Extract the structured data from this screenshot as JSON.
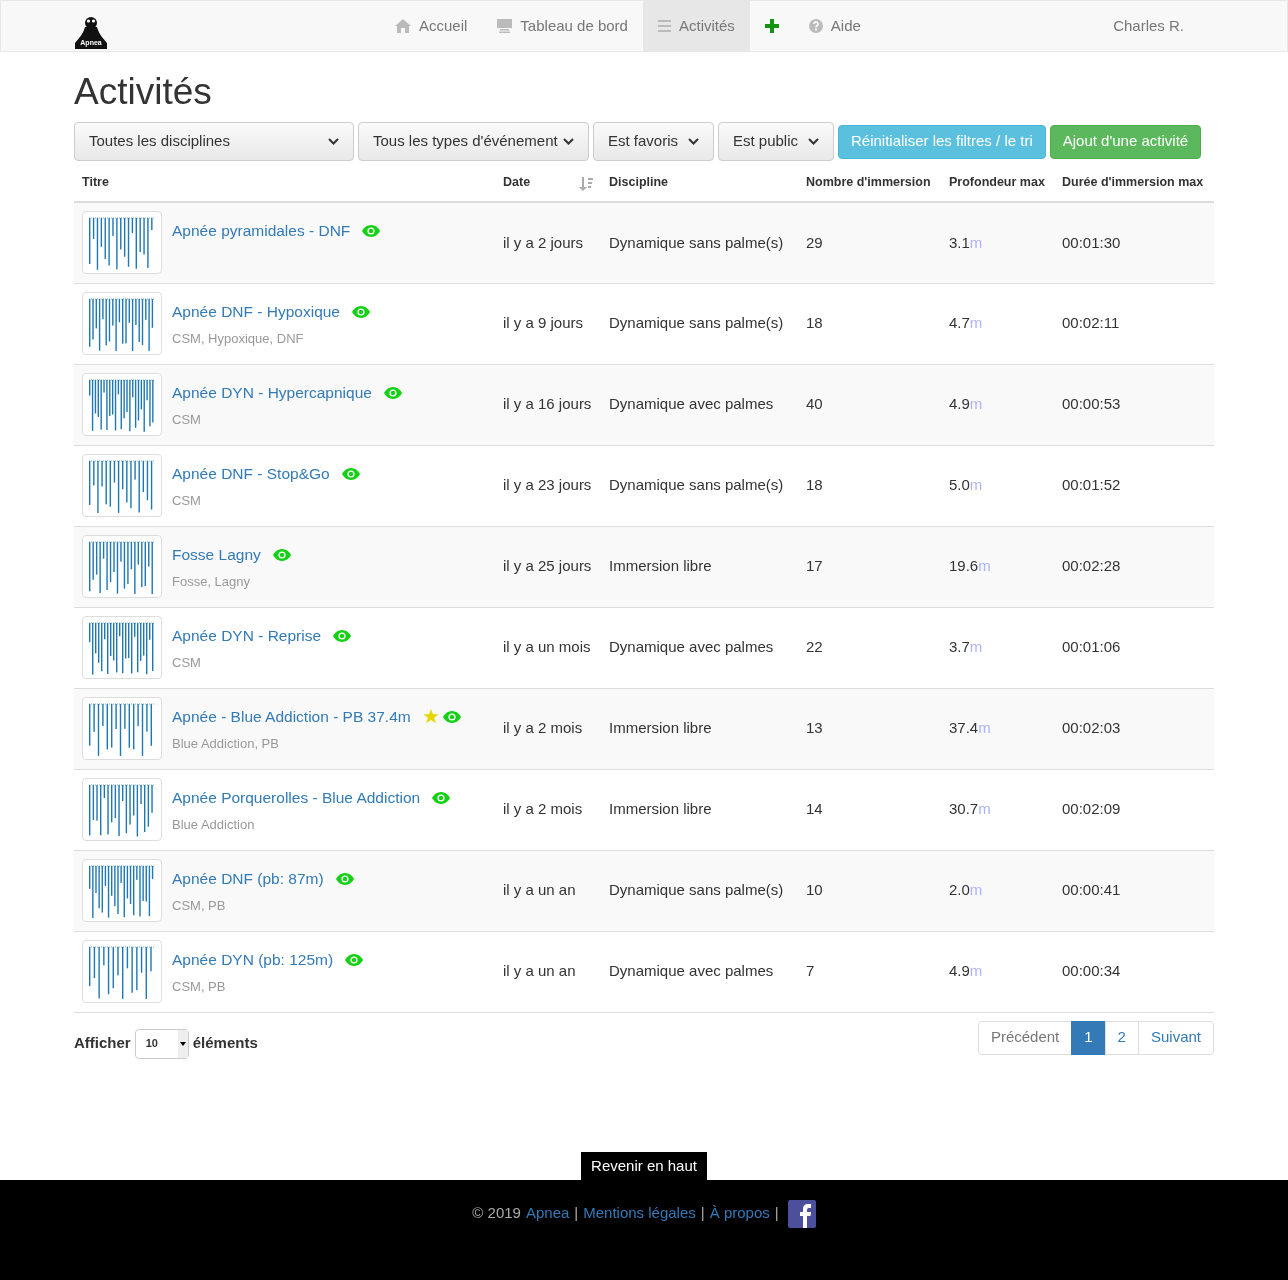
{
  "navbar": {
    "logo_text": "Apnea",
    "items": [
      {
        "kind": "home",
        "label": "Accueil",
        "selected": false
      },
      {
        "kind": "dashboard",
        "label": "Tableau de bord",
        "selected": false
      },
      {
        "kind": "list",
        "label": "Activités",
        "selected": true
      },
      {
        "kind": "add",
        "selected": false
      },
      {
        "kind": "help",
        "label": "Aide",
        "selected": false
      }
    ],
    "user": "Charles R."
  },
  "page_title": "Activités",
  "filters": [
    {
      "label": "Toutes les disciplines",
      "kind": "select"
    },
    {
      "label": "Tous les types d'événement",
      "kind": "select"
    },
    {
      "label": "Est favoris",
      "kind": "select"
    },
    {
      "label": "Est public",
      "kind": "select"
    },
    {
      "label": "Réinitialiser les filtres / le tri",
      "kind": "info"
    },
    {
      "label": "Ajout d'une activité",
      "kind": "success"
    }
  ],
  "table": {
    "columns": [
      {
        "label": "Titre"
      },
      {
        "label": "Date",
        "sorted": true
      },
      {
        "label": "Discipline"
      },
      {
        "label": "Nombre d'immersion"
      },
      {
        "label": "Profondeur max"
      },
      {
        "label": "Durée d'immersion max"
      }
    ],
    "rows": [
      {
        "title": "Apnée pyramidales - DNF",
        "favorite": false,
        "public": true,
        "date": "il y a 2 jours",
        "discipline": "Dynamique sans palme(s)",
        "count": "29",
        "depth": "3.1",
        "unit": "m",
        "duration": "00:01:30"
      },
      {
        "title": "Apnée DNF - Hypoxique",
        "tags": "CSM, Hypoxique, DNF",
        "favorite": false,
        "public": true,
        "date": "il y a 9 jours",
        "discipline": "Dynamique sans palme(s)",
        "count": "18",
        "depth": "4.7",
        "unit": "m",
        "duration": "00:02:11"
      },
      {
        "title": "Apnée DYN - Hypercapnique",
        "tags": "CSM",
        "favorite": false,
        "public": true,
        "date": "il y a 16 jours",
        "discipline": "Dynamique avec palmes",
        "count": "40",
        "depth": "4.9",
        "unit": "m",
        "duration": "00:00:53"
      },
      {
        "title": "Apnée DNF - Stop&Go",
        "tags": "CSM",
        "favorite": false,
        "public": true,
        "date": "il y a 23 jours",
        "discipline": "Dynamique sans palme(s)",
        "count": "18",
        "depth": "5.0",
        "unit": "m",
        "duration": "00:01:52"
      },
      {
        "title": "Fosse Lagny",
        "tags": "Fosse, Lagny",
        "favorite": false,
        "public": true,
        "date": "il y a 25 jours",
        "discipline": "Immersion libre",
        "count": "17",
        "depth": "19.6",
        "unit": "m",
        "duration": "00:02:28"
      },
      {
        "title": "Apnée DYN - Reprise",
        "tags": "CSM",
        "favorite": false,
        "public": true,
        "date": "il y a un mois",
        "discipline": "Dynamique avec palmes",
        "count": "22",
        "depth": "3.7",
        "unit": "m",
        "duration": "00:01:06"
      },
      {
        "title": "Apnée - Blue Addiction - PB 37.4m",
        "tags": "Blue Addiction, PB",
        "favorite": true,
        "public": true,
        "date": "il y a 2 mois",
        "discipline": "Immersion libre",
        "count": "13",
        "depth": "37.4",
        "unit": "m",
        "duration": "00:02:03"
      },
      {
        "title": "Apnée Porquerolles - Blue Addiction",
        "tags": "Blue Addiction",
        "favorite": false,
        "public": true,
        "date": "il y a 2 mois",
        "discipline": "Immersion libre",
        "count": "14",
        "depth": "30.7",
        "unit": "m",
        "duration": "00:02:09"
      },
      {
        "title": "Apnée DNF (pb: 87m)",
        "tags": "CSM, PB",
        "favorite": false,
        "public": true,
        "date": "il y a un an",
        "discipline": "Dynamique sans palme(s)",
        "count": "10",
        "depth": "2.0",
        "unit": "m",
        "duration": "00:00:41"
      },
      {
        "title": "Apnée DYN (pb: 125m)",
        "tags": "CSM, PB",
        "favorite": false,
        "public": true,
        "date": "il y a un an",
        "discipline": "Dynamique avec palmes",
        "count": "7",
        "depth": "4.9",
        "unit": "m",
        "duration": "00:00:34"
      }
    ]
  },
  "page_size": {
    "label_before": "Afficher",
    "value": "10",
    "label_after": "éléments"
  },
  "pagination": [
    {
      "label": "Précédent",
      "kind": "prev",
      "disabled": true,
      "selected": false
    },
    {
      "label": "1",
      "kind": "page",
      "selected": true
    },
    {
      "label": "2",
      "kind": "page",
      "selected": false
    },
    {
      "label": "Suivant",
      "kind": "next",
      "disabled": false,
      "selected": false
    }
  ],
  "back_to_top": "Revenir en haut",
  "footer": [
    {
      "text": "© 2019",
      "kind": "text"
    },
    {
      "text": "Apnea",
      "kind": "link"
    },
    {
      "text": "|",
      "kind": "text"
    },
    {
      "text": "Mentions légales",
      "kind": "link"
    },
    {
      "text": "|",
      "kind": "text"
    },
    {
      "text": "À propos",
      "kind": "link"
    },
    {
      "text": "|",
      "kind": "text"
    },
    {
      "kind": "facebook"
    }
  ]
}
